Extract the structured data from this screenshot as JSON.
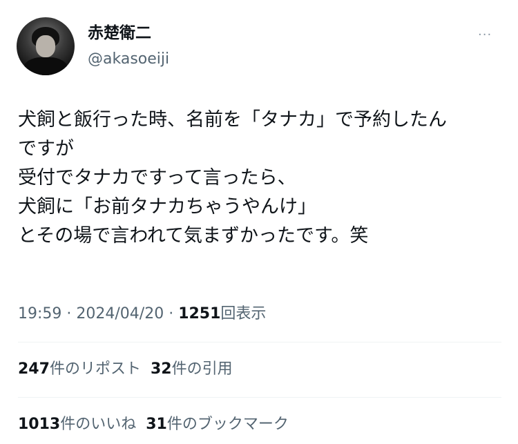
{
  "author": {
    "name": "赤楚衛二",
    "handle": "@akasoeiji"
  },
  "more_icon": "···",
  "tweet_lines": [
    "犬飼と飯行った時、名前を「タナカ」で予約したん",
    "ですが",
    "受付でタナカですって言ったら、",
    "犬飼に「お前タナカちゃうやんけ」",
    "とその場で言われて気まずかったです。笑"
  ],
  "meta": {
    "time": "19:59",
    "separator": " · ",
    "date": "2024/04/20",
    "views_count": "1251",
    "views_label": "回表示"
  },
  "stats_row1": {
    "reposts_count": "247",
    "reposts_label": "件のリポスト",
    "quotes_count": "32",
    "quotes_label": "件の引用"
  },
  "stats_row2": {
    "likes_count": "1013",
    "likes_label": "件のいいね",
    "bookmarks_count": "31",
    "bookmarks_label": "件のブックマーク"
  }
}
